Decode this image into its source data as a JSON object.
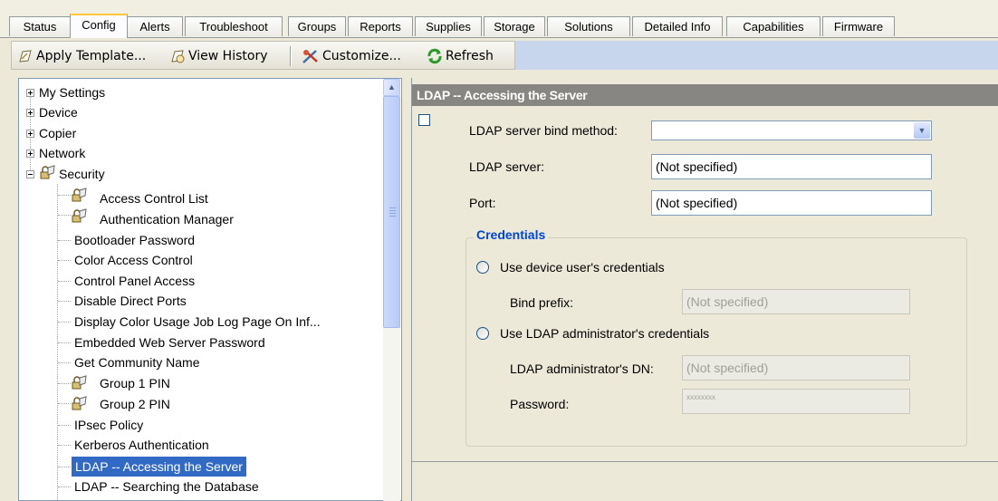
{
  "tabs": [
    {
      "label": "Status"
    },
    {
      "label": "Config"
    },
    {
      "label": "Alerts"
    },
    {
      "label": "Troubleshoot"
    },
    {
      "label": "Groups"
    },
    {
      "label": "Reports"
    },
    {
      "label": "Supplies"
    },
    {
      "label": "Storage"
    },
    {
      "label": "Solutions"
    },
    {
      "label": "Detailed Info"
    },
    {
      "label": "Capabilities"
    },
    {
      "label": "Firmware"
    }
  ],
  "active_tab": "Config",
  "toolbar": {
    "apply_template": "Apply Template...",
    "view_history": "View History",
    "customize": "Customize...",
    "refresh": "Refresh"
  },
  "tree": {
    "top_level": [
      {
        "label": "My Settings"
      },
      {
        "label": "Device"
      },
      {
        "label": "Copier"
      },
      {
        "label": "Network"
      },
      {
        "label": "Security"
      }
    ],
    "security_children": [
      {
        "label": "Access Control List"
      },
      {
        "label": "Authentication Manager"
      },
      {
        "label": "Bootloader Password"
      },
      {
        "label": "Color Access Control"
      },
      {
        "label": "Control Panel Access"
      },
      {
        "label": "Disable Direct Ports"
      },
      {
        "label": "Display Color Usage Job Log Page On Inf..."
      },
      {
        "label": "Embedded Web Server Password"
      },
      {
        "label": "Get Community Name"
      },
      {
        "label": "Group 1 PIN"
      },
      {
        "label": "Group 2 PIN"
      },
      {
        "label": "IPsec Policy"
      },
      {
        "label": "Kerberos Authentication"
      },
      {
        "label": "LDAP -- Accessing the Server"
      },
      {
        "label": "LDAP -- Searching the Database"
      }
    ],
    "selected": "LDAP -- Accessing the Server"
  },
  "panel": {
    "title": "LDAP -- Accessing the Server",
    "bind_method_label": "LDAP server bind method:",
    "bind_method_value": "",
    "server_label": "LDAP server:",
    "server_value": "(Not specified)",
    "port_label": "Port:",
    "port_value": "(Not specified)",
    "credentials": {
      "title": "Credentials",
      "use_device_user": "Use device user's credentials",
      "bind_prefix_label": "Bind prefix:",
      "bind_prefix_value": "(Not specified)",
      "use_ldap_admin": "Use LDAP administrator's credentials",
      "admin_dn_label": "LDAP administrator's DN:",
      "admin_dn_value": "(Not specified)",
      "password_label": "Password:",
      "password_value": "xxxxxxxx"
    }
  }
}
